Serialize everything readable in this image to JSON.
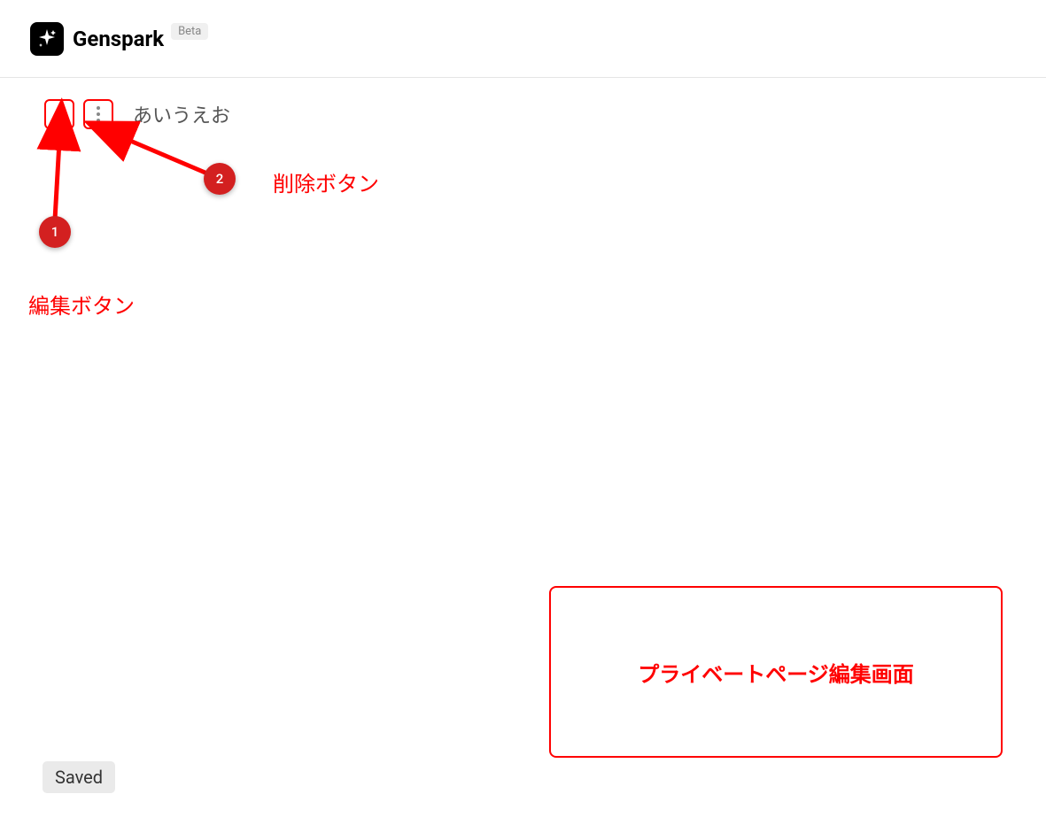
{
  "header": {
    "brand": "Genspark",
    "badge": "Beta"
  },
  "block": {
    "text": "あいうえお"
  },
  "annotations": {
    "marker1": "1",
    "marker2": "2",
    "label_delete": "削除ボタン",
    "label_edit": "編集ボタン",
    "info_box": "プライベートページ編集画面"
  },
  "status": {
    "saved": "Saved"
  },
  "colors": {
    "annotation_red": "#ff0000",
    "marker_red": "#d32020"
  }
}
